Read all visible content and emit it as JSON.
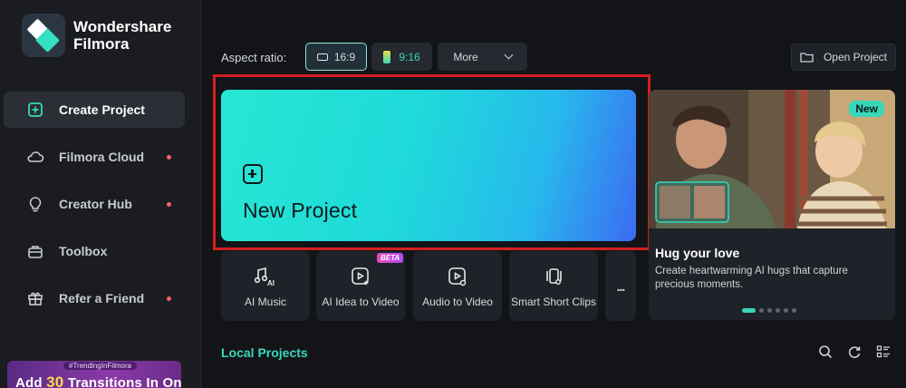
{
  "app": {
    "name": "Wondershare Filmora",
    "name_line1": "Wondershare",
    "name_line2": "Filmora"
  },
  "sidebar": {
    "items": [
      {
        "label": "Create Project",
        "icon": "plus-square-icon",
        "active": true,
        "dot": false
      },
      {
        "label": "Filmora Cloud",
        "icon": "cloud-icon",
        "active": false,
        "dot": true
      },
      {
        "label": "Creator Hub",
        "icon": "bulb-icon",
        "active": false,
        "dot": true
      },
      {
        "label": "Toolbox",
        "icon": "toolbox-icon",
        "active": false,
        "dot": false
      },
      {
        "label": "Refer a Friend",
        "icon": "gift-icon",
        "active": false,
        "dot": true
      }
    ],
    "promo": {
      "tag": "#TrendingInFilmora",
      "title_prefix": "Add ",
      "title_number": "30",
      "title_suffix": " Transitions In One Tap!"
    }
  },
  "aspect": {
    "label": "Aspect ratio:",
    "options": [
      "16:9",
      "9:16"
    ],
    "selected": "16:9",
    "more_label": "More"
  },
  "open_project_label": "Open Project",
  "new_project": {
    "title": "New Project"
  },
  "tools": [
    {
      "label": "AI Music",
      "icon": "ai-music-icon"
    },
    {
      "label": "AI Idea to Video",
      "icon": "ai-idea-video-icon",
      "badge": "BETA"
    },
    {
      "label": "Audio to Video",
      "icon": "audio-video-icon"
    },
    {
      "label": "Smart Short Clips",
      "icon": "short-clips-icon"
    },
    {
      "label": "...",
      "icon": "more-icon"
    }
  ],
  "feature": {
    "badge": "New",
    "title": "Hug your love",
    "description": "Create heartwarming AI hugs that capture precious moments.",
    "pages": 6,
    "current_page": 1
  },
  "local_projects": {
    "title": "Local Projects"
  },
  "colors": {
    "accent": "#39d7b9",
    "highlight_frame": "#d41f1f",
    "notification_dot": "#ff5f6d"
  }
}
